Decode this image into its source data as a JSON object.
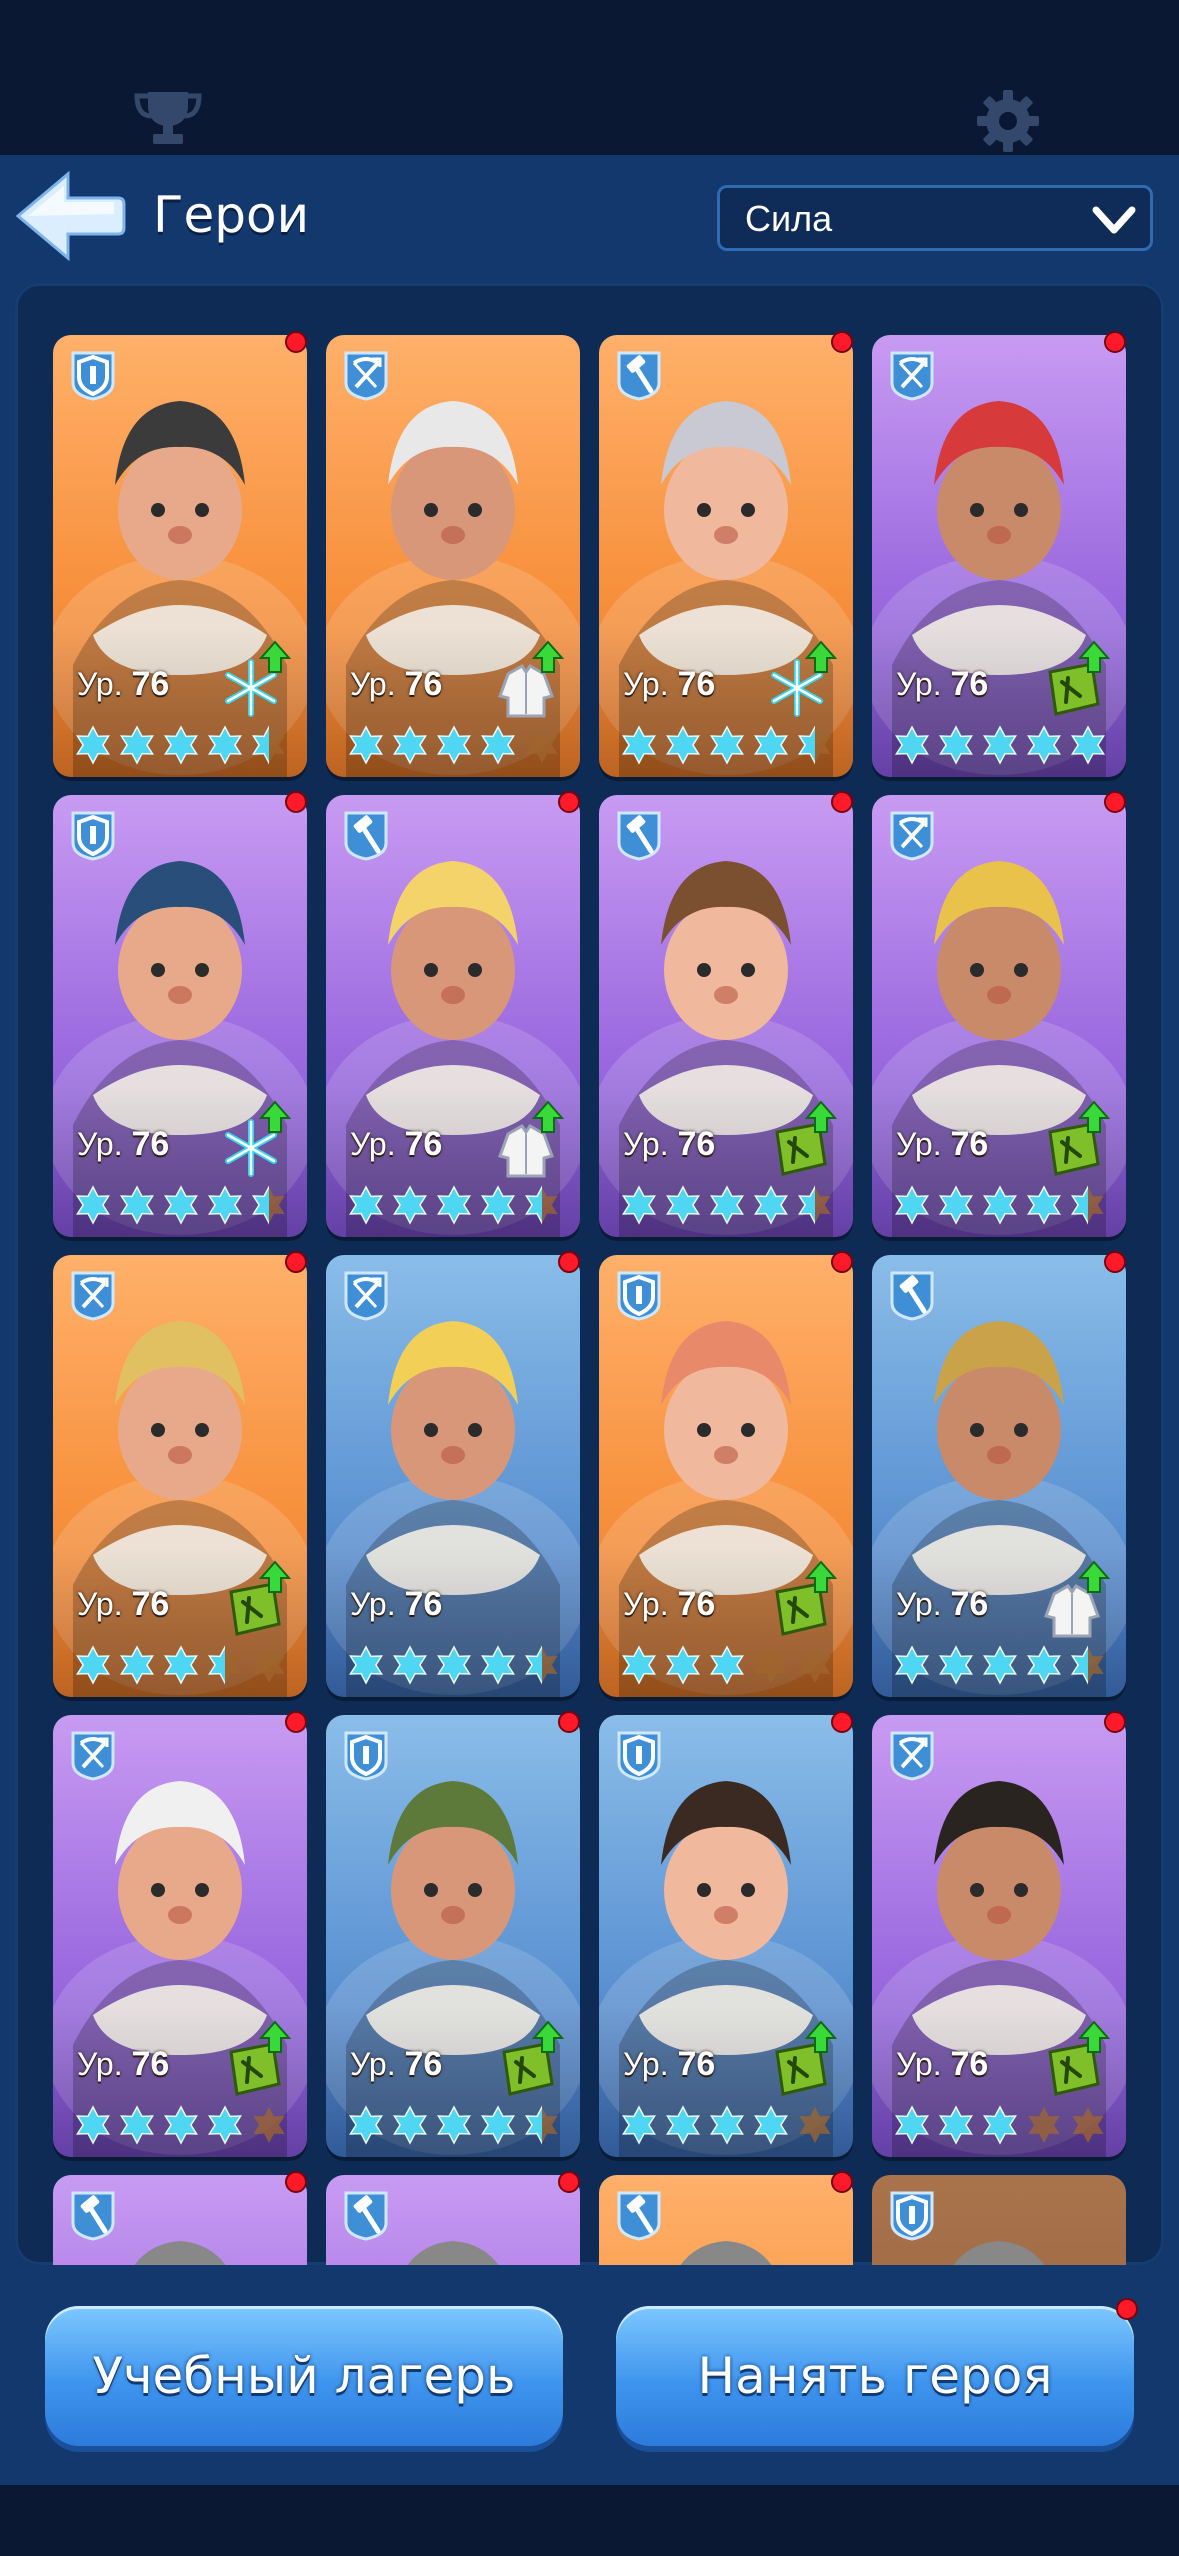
{
  "header": {
    "title": "Герои",
    "sort_label": "Сила"
  },
  "level_prefix": "Ур.",
  "colors": {
    "orange": "#f7923f",
    "purple": "#9d6ce0",
    "blue": "#5f96d4",
    "star_active": "#4fd6f2",
    "star_inactive": "#a0652e",
    "notification": "#ff1a2a"
  },
  "heroes": [
    {
      "bg": "orange",
      "type": "shield-icon",
      "level": "76",
      "stars": 4.5,
      "action": "snowflake-upgrade-icon",
      "notify": true
    },
    {
      "bg": "orange",
      "type": "crossbow-icon",
      "level": "76",
      "stars": 4,
      "action": "coat-upgrade-icon",
      "notify": false
    },
    {
      "bg": "orange",
      "type": "hammer-icon",
      "level": "76",
      "stars": 4.5,
      "action": "snowflake-upgrade-icon",
      "notify": true
    },
    {
      "bg": "purple",
      "type": "crossbow-icon",
      "level": "76",
      "stars": 5,
      "action": "book-upgrade-icon",
      "notify": true
    },
    {
      "bg": "purple",
      "type": "shield-icon",
      "level": "76",
      "stars": 4.5,
      "action": "snowflake-upgrade-icon",
      "notify": true
    },
    {
      "bg": "purple",
      "type": "hammer-icon",
      "level": "76",
      "stars": 4.5,
      "action": "coat-upgrade-icon",
      "notify": true
    },
    {
      "bg": "purple",
      "type": "hammer-icon",
      "level": "76",
      "stars": 4.5,
      "action": "book-upgrade-icon",
      "notify": true
    },
    {
      "bg": "purple",
      "type": "crossbow-icon",
      "level": "76",
      "stars": 4.5,
      "action": "book-upgrade-icon",
      "notify": true
    },
    {
      "bg": "orange",
      "type": "crossbow-icon",
      "level": "76",
      "stars": 3.5,
      "action": "book-upgrade-icon",
      "notify": true
    },
    {
      "bg": "blue",
      "type": "crossbow-icon",
      "level": "76",
      "stars": 4.5,
      "action": "",
      "notify": true
    },
    {
      "bg": "orange",
      "type": "shield-icon",
      "level": "76",
      "stars": 3,
      "action": "book-upgrade-icon",
      "notify": true
    },
    {
      "bg": "blue",
      "type": "hammer-icon",
      "level": "76",
      "stars": 4.5,
      "action": "coat-upgrade-icon",
      "notify": true
    },
    {
      "bg": "purple",
      "type": "crossbow-icon",
      "level": "76",
      "stars": 4,
      "action": "book-upgrade-icon",
      "notify": true
    },
    {
      "bg": "blue",
      "type": "shield-icon",
      "level": "76",
      "stars": 4.5,
      "action": "book-upgrade-icon",
      "notify": true
    },
    {
      "bg": "blue",
      "type": "shield-icon",
      "level": "76",
      "stars": 4,
      "action": "book-upgrade-icon",
      "notify": true
    },
    {
      "bg": "purple",
      "type": "crossbow-icon",
      "level": "76",
      "stars": 3,
      "action": "book-upgrade-icon",
      "notify": true
    },
    {
      "bg": "purple",
      "type": "hammer-icon",
      "level": "",
      "stars": 0,
      "action": "",
      "notify": true
    },
    {
      "bg": "purple",
      "type": "hammer-icon",
      "level": "",
      "stars": 0,
      "action": "",
      "notify": true
    },
    {
      "bg": "orange",
      "type": "hammer-icon",
      "level": "",
      "stars": 0,
      "action": "",
      "notify": true
    },
    {
      "bg": "brown",
      "type": "shield-icon",
      "level": "",
      "stars": 0,
      "action": "",
      "notify": false
    }
  ],
  "buttons": {
    "training_camp": "Учебный лагерь",
    "hire_hero": "Нанять героя"
  }
}
